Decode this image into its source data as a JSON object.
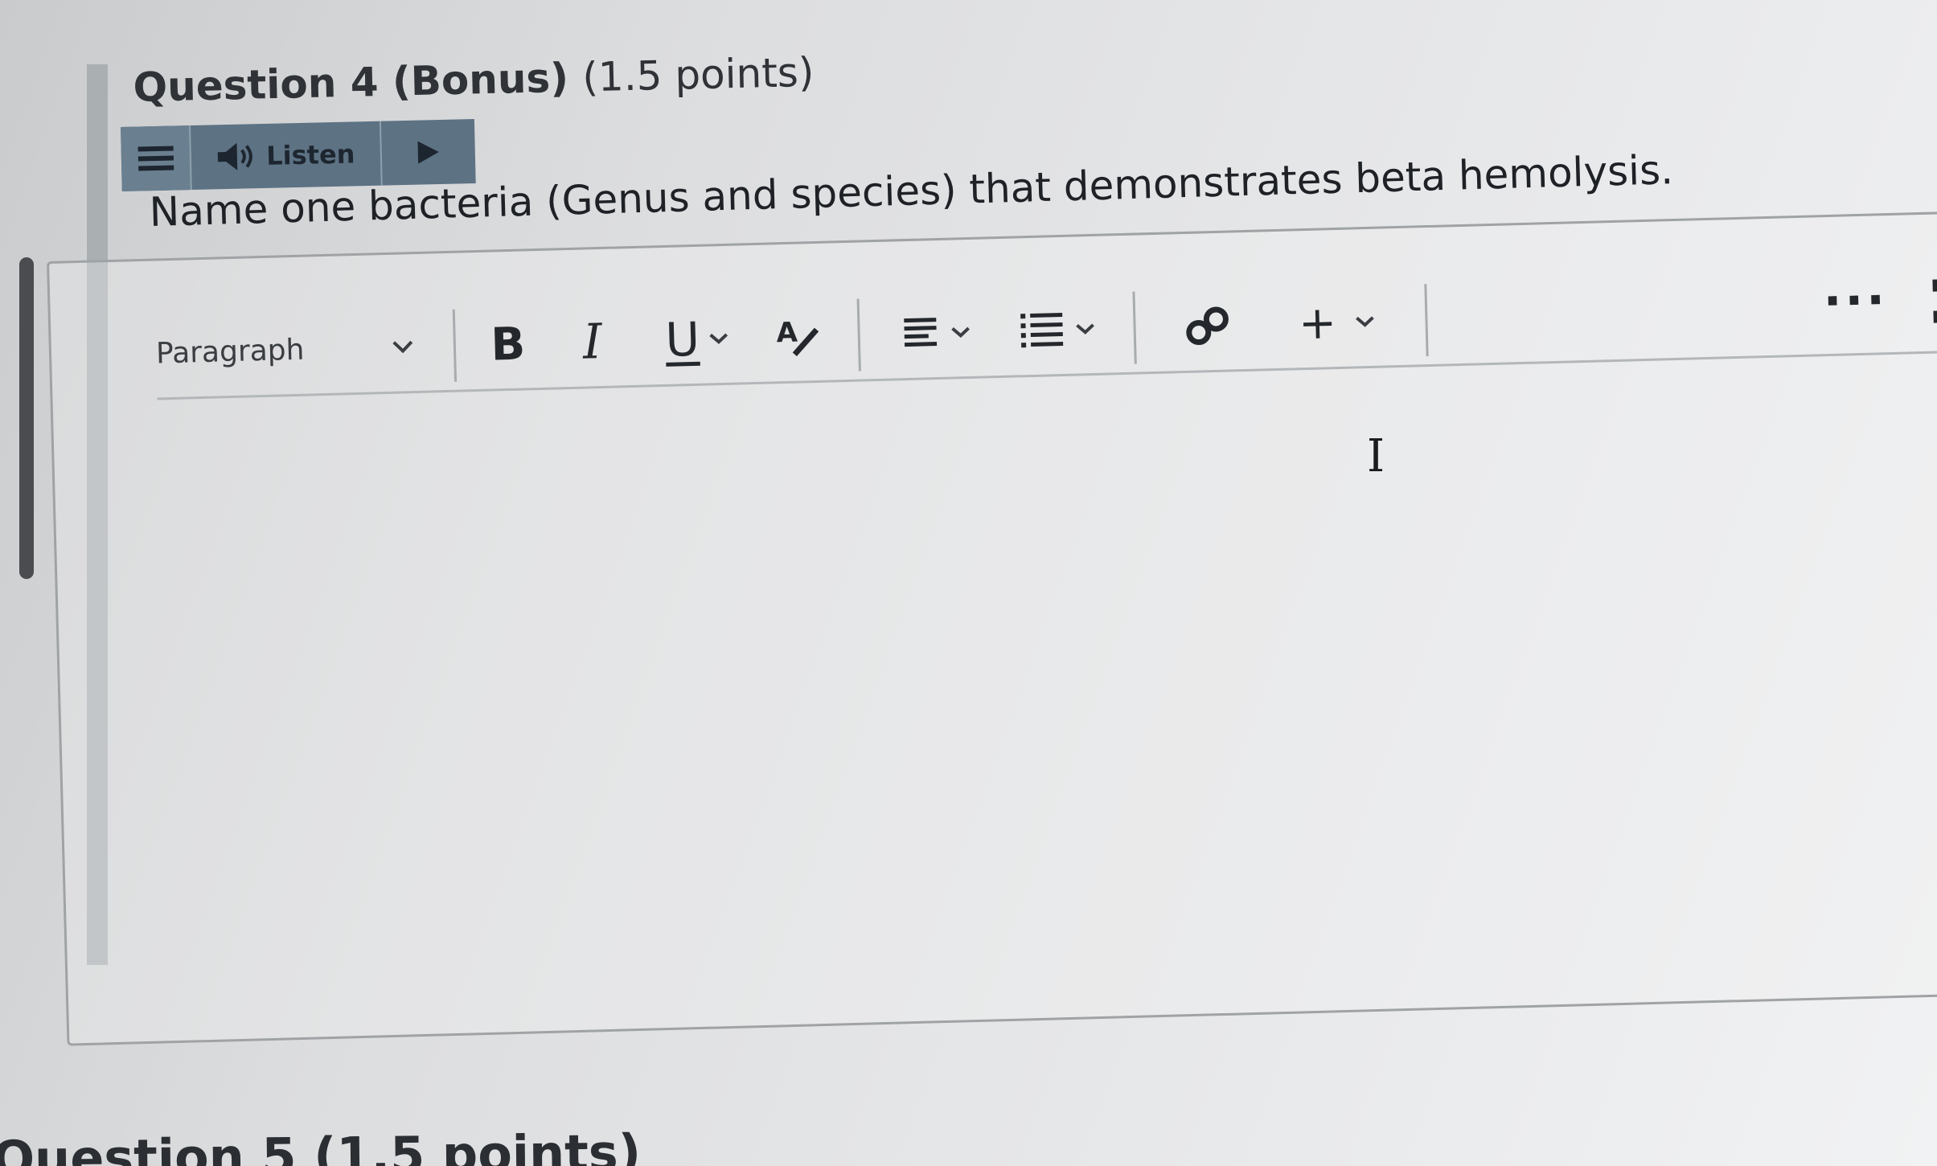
{
  "question": {
    "title": "Question 4 (Bonus)",
    "points": "(1.5 points)",
    "prompt": "Name one bacteria (Genus and species) that demonstrates beta hemolysis."
  },
  "listen_bar": {
    "listen_label": "Listen"
  },
  "editor": {
    "block_format": "Paragraph",
    "bold_label": "B",
    "italic_label": "I",
    "underline_label": "U",
    "format_label": "A",
    "plus_label": "+",
    "more_label": "···",
    "content": ""
  },
  "next_question": {
    "title": "Question 5 (1.5 points)"
  },
  "colors": {
    "listen_bar_bg": "#5d7283",
    "text": "#1e2125",
    "accent_bar": "#aab0b2"
  }
}
